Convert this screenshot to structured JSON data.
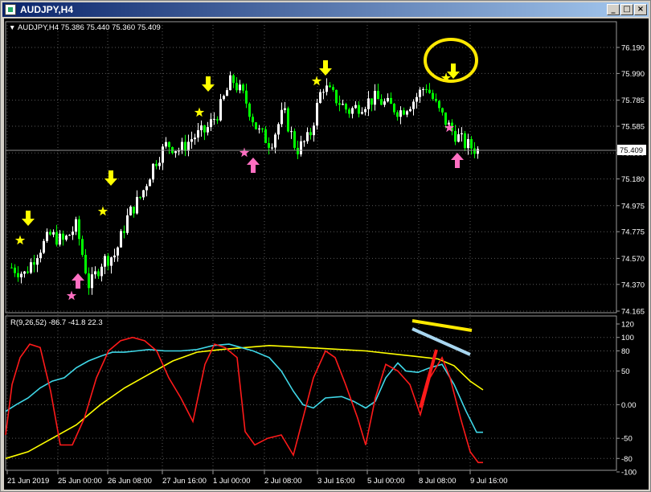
{
  "window": {
    "title": "AUDJPY,H4"
  },
  "colors": {
    "bull": "#ffffff",
    "bear": "#00ff00",
    "grid": "#5a5a5a",
    "yellow": "#ffff00",
    "pink": "#ff6fc2",
    "red": "#ff1a1a",
    "cyan": "#3fd8e8",
    "lightblue": "#a8d6f0"
  },
  "main_chart": {
    "info": "AUDJPY,H4  75.386 75.440 75.360 75.409",
    "price_tag": "75.409",
    "price_ticks": [
      "76.190",
      "75.990",
      "75.785",
      "75.585",
      "75.380",
      "75.180",
      "74.975",
      "74.775",
      "74.570",
      "74.370",
      "74.165"
    ]
  },
  "indicator": {
    "label": "R(9,26,52) -86.7 -41.8 22.3",
    "ticks": [
      "120",
      "100",
      "80",
      "50",
      "0.00",
      "-50",
      "-80",
      "-100"
    ]
  },
  "time_axis": [
    "21 Jun 2019",
    "25 Jun 00:00",
    "26 Jun 08:00",
    "27 Jun 16:00",
    "1 Jul 00:00",
    "2 Jul 08:00",
    "3 Jul 16:00",
    "5 Jul 00:00",
    "8 Jul 08:00",
    "9 Jul 16:00"
  ],
  "chart_data": [
    {
      "type": "candlestick",
      "title": "AUDJPY,H4",
      "y_axis_ticks": [
        76.19,
        75.99,
        75.785,
        75.585,
        75.38,
        75.18,
        74.975,
        74.775,
        74.57,
        74.37,
        74.165
      ],
      "ylim": [
        74.165,
        76.19
      ],
      "last_price": 75.409,
      "ohlc_last": {
        "open": 75.386,
        "high": 75.44,
        "low": 75.36,
        "close": 75.409
      },
      "approx_path": [
        74.5,
        74.45,
        74.62,
        74.75,
        74.7,
        74.82,
        74.35,
        74.55,
        74.6,
        74.9,
        75.05,
        75.3,
        75.45,
        75.4,
        75.5,
        75.55,
        75.7,
        75.95,
        75.8,
        75.55,
        75.45,
        75.7,
        75.4,
        75.5,
        75.9,
        75.8,
        75.7,
        75.75,
        75.8,
        75.75,
        75.7,
        75.78,
        75.9,
        75.7,
        75.55,
        75.45,
        75.4
      ]
    },
    {
      "type": "line",
      "title": "R(9,26,52)",
      "series": [
        {
          "name": "9",
          "color": "#ff1a1a",
          "last": -86.7
        },
        {
          "name": "26",
          "color": "#3fd8e8",
          "last": -41.8
        },
        {
          "name": "52",
          "color": "#ffff00",
          "last": 22.3
        }
      ],
      "ylim": [
        -100,
        120
      ],
      "y_axis_ticks": [
        120,
        100,
        80,
        50,
        0,
        -50,
        -80,
        -100
      ]
    }
  ]
}
